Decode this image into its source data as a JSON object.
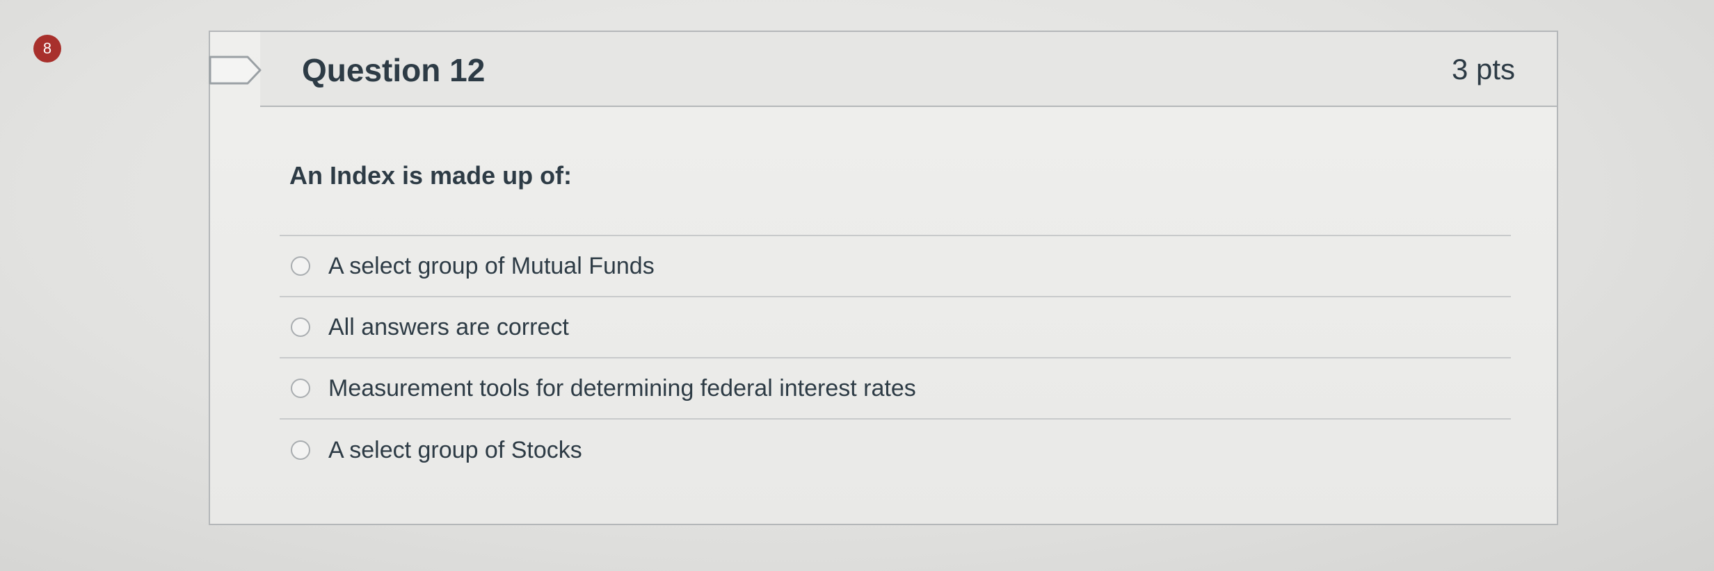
{
  "question_number_badge": "8",
  "question": {
    "title": "Question 12",
    "points": "3 pts",
    "text": "An Index is made up of:",
    "answers": [
      {
        "label": "A select group of Mutual Funds"
      },
      {
        "label": "All answers are correct"
      },
      {
        "label": "Measurement tools for determining federal interest rates"
      },
      {
        "label": "A select group of Stocks"
      }
    ]
  },
  "colors": {
    "badge": "#a8302c",
    "text": "#2d3b45",
    "border": "#b4b7b9"
  },
  "icons": {
    "flag": "flag-icon",
    "radio": "radio-button"
  }
}
